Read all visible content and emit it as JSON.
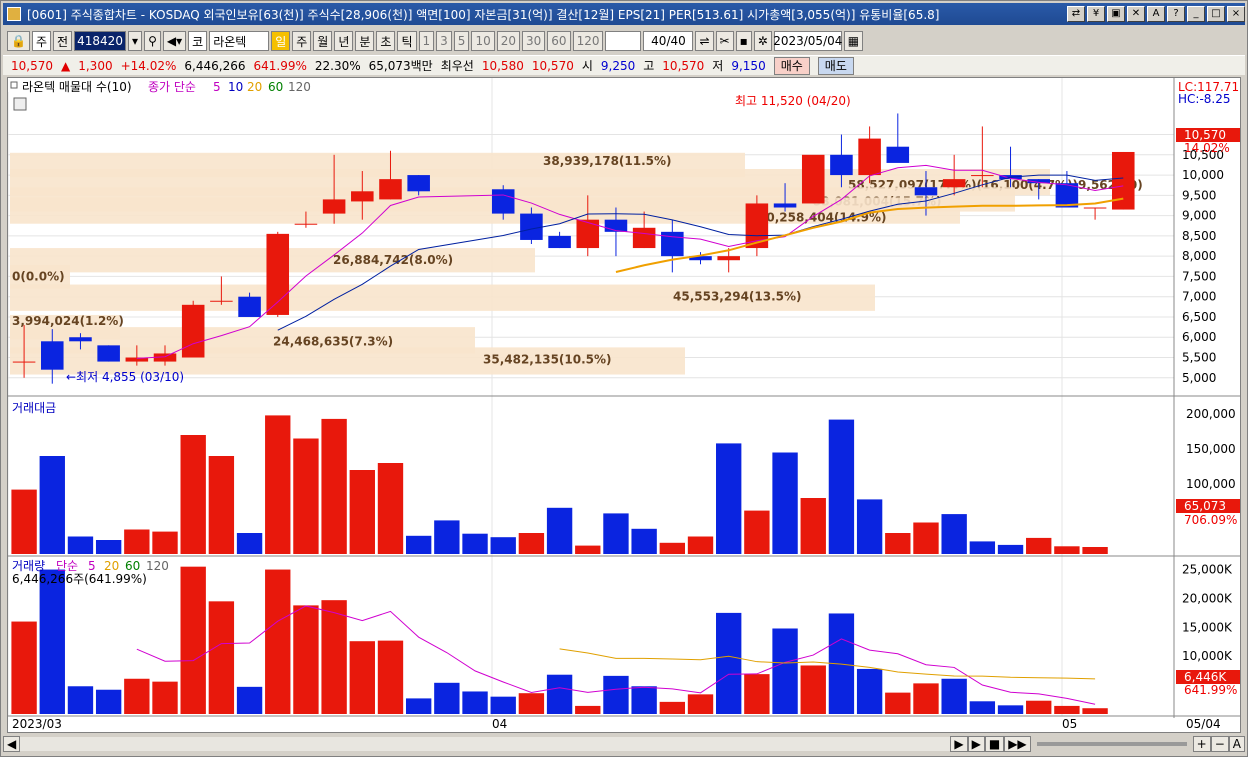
{
  "title": "[0601] 주식종합차트 - KOSDAQ 외국인보유[63(천)] 주식수[28,906(천)] 액면[100] 자본금[31(억)] 결산[12월] EPS[21] PER[513.61] 시가총액[3,055(억)] 유통비율[65.8]",
  "toolbar": {
    "period_type": "주",
    "prev": "전",
    "code": "418420",
    "name_prefix": "코",
    "name": "라온텍",
    "day": "일",
    "week": "주",
    "month": "월",
    "year": "년",
    "minute": "분",
    "second": "초",
    "tick": "틱",
    "nums": [
      "1",
      "3",
      "5",
      "10",
      "20",
      "30",
      "60",
      "120"
    ],
    "count": "40",
    "count_total": "/40",
    "date": "2023/05/04"
  },
  "price": {
    "last": "10,570",
    "arrow": "▲",
    "change": "1,300",
    "pct": "+14.02%",
    "volume": "6,446,266",
    "vol_pct": "641.99%",
    "turnover": "22.30%",
    "amount": "65,073백만",
    "best_label": "최우선",
    "ask": "10,580",
    "bid": "10,570",
    "open_l": "시",
    "open": "9,250",
    "high_l": "고",
    "high": "10,570",
    "low_l": "저",
    "low": "9,150",
    "buy": "매수",
    "sell": "매도"
  },
  "legend": {
    "vp": "라온텍 매물대 수(10)",
    "ma": "종가 단순",
    "m5": "5",
    "m10": "10",
    "m20": "20",
    "m60": "60",
    "m120": "120"
  },
  "annot": {
    "high": "최고 11,520 (04/20)",
    "low": "←최저 4,855 (03/10)",
    "lc": "LC:117.71",
    "hc": "HC:-8.25",
    "pricebox": "10,570",
    "pricepct": "14.02%"
  },
  "vp": [
    {
      "t": "38,939,178(11.5%)"
    },
    {
      "t": "58,527,097(17.4%)(16,100(4.7%))9,562,00)"
    },
    {
      "t": "53,081,004(15.7%)"
    },
    {
      "t": "50,258,404(14.9%)"
    },
    {
      "t": "26,884,742(8.0%)"
    },
    {
      "t": "0(0.0%)"
    },
    {
      "t": "45,553,294(13.5%)"
    },
    {
      "t": "3,994,024(1.2%)"
    },
    {
      "t": "24,468,635(7.3%)"
    },
    {
      "t": "35,482,135(10.5%)"
    }
  ],
  "yaxis": [
    "11,000",
    "10,500",
    "10,000",
    "9,500",
    "9,000",
    "8,500",
    "8,000",
    "7,500",
    "7,000",
    "6,500",
    "6,000",
    "5,500",
    "5,000"
  ],
  "amt": {
    "title": "거래대금",
    "ticks": [
      "200,000",
      "150,000",
      "100,000"
    ],
    "box": "65,073",
    "pct": "706.09%"
  },
  "vol": {
    "title": "거래량",
    "ma": "단순",
    "m5": "5",
    "m20": "20",
    "m60": "60",
    "m120": "120",
    "info": "6,446,266주(641.99%)",
    "ticks": [
      "25,000K",
      "20,000K",
      "15,000K",
      "10,000K"
    ],
    "box": "6,446K",
    "pct": "641.99%"
  },
  "xaxis": [
    "2023/03",
    "04",
    "05",
    "05/04"
  ],
  "chart_data": {
    "type": "candlestick",
    "candles": [
      [
        5400,
        6300,
        5000,
        5400
      ],
      [
        5900,
        6200,
        4855,
        5200
      ],
      [
        6000,
        6100,
        5700,
        5900
      ],
      [
        5800,
        5800,
        5400,
        5400
      ],
      [
        5400,
        5800,
        5300,
        5500
      ],
      [
        5400,
        5800,
        5300,
        5600
      ],
      [
        5500,
        6900,
        5500,
        6800
      ],
      [
        6900,
        7500,
        6800,
        6900
      ],
      [
        7000,
        7100,
        6700,
        6500
      ],
      [
        6550,
        8600,
        6500,
        8550
      ],
      [
        8800,
        9100,
        8700,
        8800
      ],
      [
        9050,
        10500,
        8800,
        9400
      ],
      [
        9350,
        10100,
        8900,
        9600
      ],
      [
        9400,
        10600,
        9400,
        9900
      ],
      [
        10000,
        10000,
        9500,
        9600
      ],
      [
        9650,
        9750,
        8900,
        9050
      ],
      [
        9050,
        9200,
        8300,
        8400
      ],
      [
        8500,
        8600,
        8200,
        8200
      ],
      [
        8200,
        9500,
        8000,
        8900
      ],
      [
        8900,
        9200,
        8000,
        8600
      ],
      [
        8200,
        9100,
        8200,
        8700
      ],
      [
        8600,
        8900,
        7600,
        8000
      ],
      [
        8000,
        8100,
        7800,
        7900
      ],
      [
        7900,
        8200,
        7600,
        8000
      ],
      [
        8200,
        9500,
        8000,
        9300
      ],
      [
        9300,
        9800,
        9100,
        9200
      ],
      [
        9300,
        10300,
        9300,
        10500
      ],
      [
        10500,
        11000,
        9700,
        10000
      ],
      [
        10000,
        11200,
        9800,
        10900
      ],
      [
        10700,
        11520,
        10400,
        10300
      ],
      [
        9700,
        10100,
        9000,
        9500
      ],
      [
        9700,
        10500,
        9500,
        9900
      ],
      [
        10000,
        11200,
        9700,
        10000
      ],
      [
        10000,
        10700,
        9700,
        9900
      ],
      [
        9900,
        9900,
        9400,
        9800
      ],
      [
        9800,
        10100,
        9300,
        9200
      ],
      [
        9200,
        9200,
        8900,
        9200
      ],
      [
        9150,
        10570,
        9150,
        10570
      ]
    ],
    "amount": [
      92000,
      140000,
      25000,
      20000,
      35000,
      32000,
      170000,
      140000,
      30000,
      198000,
      165000,
      193000,
      120000,
      130000,
      26000,
      48000,
      29000,
      24000,
      30000,
      66000,
      12000,
      58000,
      36000,
      16000,
      25000,
      158000,
      62000,
      145000,
      80000,
      192000,
      78000,
      30000,
      45000,
      57000,
      18000,
      13000,
      23000,
      11000,
      10000,
      65073
    ],
    "volume": [
      16000,
      25000,
      4800,
      4200,
      6100,
      5600,
      25500,
      19500,
      4700,
      25000,
      18800,
      19700,
      12600,
      12700,
      2700,
      5400,
      3900,
      3000,
      3600,
      6800,
      1400,
      6600,
      4800,
      2100,
      3400,
      17500,
      6900,
      14800,
      8400,
      17400,
      7800,
      3700,
      5300,
      6100,
      2200,
      1500,
      2300,
      1400,
      1000,
      6446
    ],
    "up_color": "#e8180c",
    "down_color": "#0a24e0",
    "ylim": [
      4600,
      12000
    ]
  }
}
